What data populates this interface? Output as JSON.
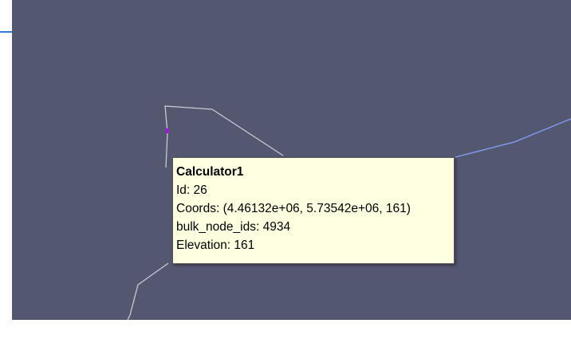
{
  "viewport": {
    "background": "#545770",
    "line_color": "#c9c9d3",
    "highlight_color": "#7f95e8",
    "selected_point_color": "#b300ff"
  },
  "tooltip": {
    "title": "Calculator1",
    "id": "Id: 26",
    "coords": "Coords: (4.46132e+06, 5.73542e+06, 161)",
    "bulk_node_ids": "bulk_node_ids: 4934",
    "elevation": "Elevation: 161"
  }
}
